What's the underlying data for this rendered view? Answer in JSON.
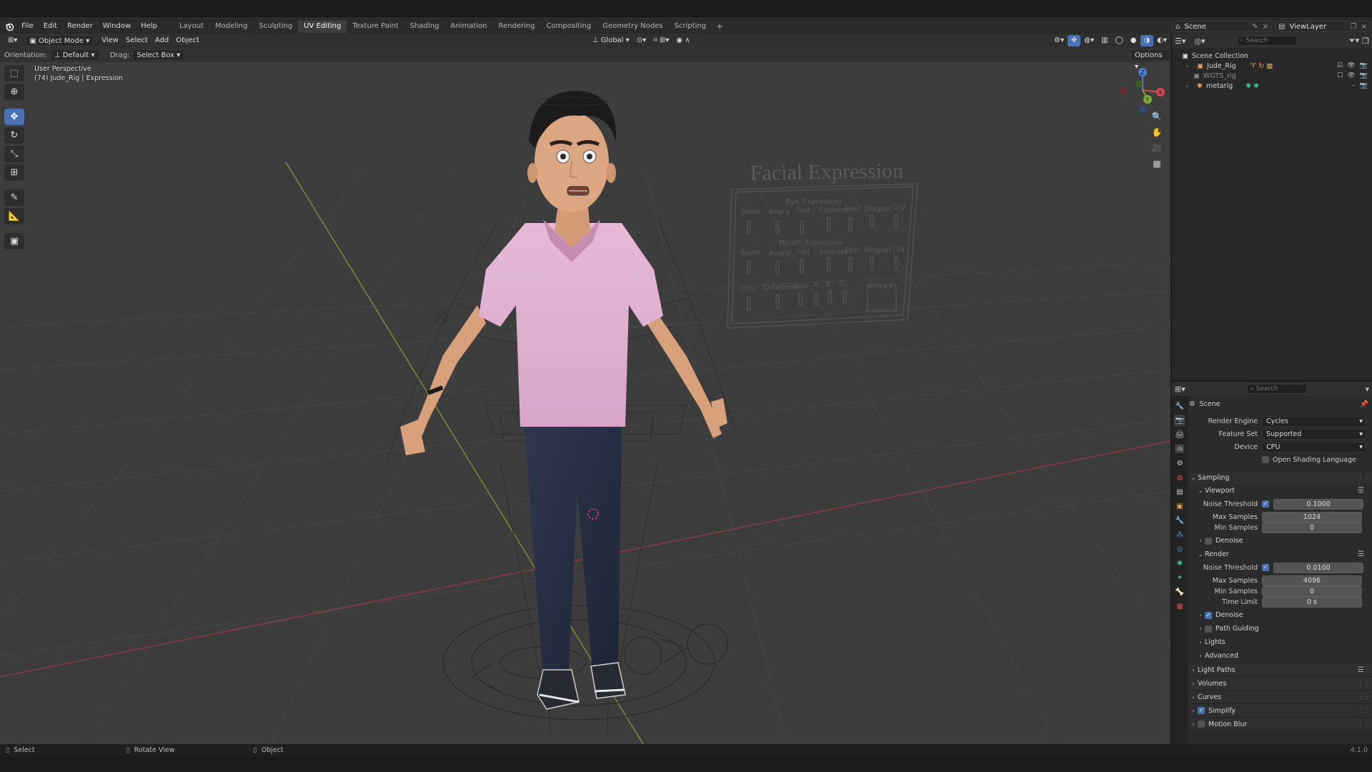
{
  "menu": [
    "File",
    "Edit",
    "Render",
    "Window",
    "Help"
  ],
  "workspaces": [
    {
      "label": "Layout",
      "active": false
    },
    {
      "label": "Modeling",
      "active": false
    },
    {
      "label": "Sculpting",
      "active": false
    },
    {
      "label": "UV Editing",
      "active": true
    },
    {
      "label": "Texture Paint",
      "active": false
    },
    {
      "label": "Shading",
      "active": false
    },
    {
      "label": "Animation",
      "active": false
    },
    {
      "label": "Rendering",
      "active": false
    },
    {
      "label": "Compositing",
      "active": false
    },
    {
      "label": "Geometry Nodes",
      "active": false
    },
    {
      "label": "Scripting",
      "active": false
    }
  ],
  "add_workspace": "+",
  "scene_selector": "Scene",
  "view_layer": "ViewLayer",
  "viewport": {
    "mode": "Object Mode",
    "menus": [
      "View",
      "Select",
      "Add",
      "Object"
    ],
    "transform_orientation": "Global",
    "orientation_label": "Orientation:",
    "orientation_value": "Default",
    "drag_label": "Drag:",
    "drag_value": "Select Box",
    "options": "Options",
    "perspective": "User Perspective",
    "object_info": "(74) Jude_Rig | Expression",
    "gizmo_axes": [
      "X",
      "Y",
      "Z"
    ]
  },
  "scene_text": {
    "board_title": "Facial Expression",
    "eye_section": "Eye_Expression",
    "eye_labels": [
      "Smile",
      "Angry",
      "Sad",
      "Surprise",
      "Fear",
      "Disgust",
      "Cry"
    ],
    "mouth_section": "Mouth_Expression",
    "mouth_labels": [
      "Smile",
      "Angry",
      "Sad",
      "Surprise",
      "Fear",
      "Disgust",
      "Cry"
    ],
    "extra_labels": [
      "Cute",
      "CuteSmile",
      "Kiss",
      "A",
      "E",
      "O"
    ],
    "blink_label": "Blink L R"
  },
  "outliner": {
    "search_placeholder": "Search",
    "root": "Scene Collection",
    "items": [
      {
        "name": "Jude_Rig",
        "dim": false
      },
      {
        "name": "WGTS_rig",
        "dim": true
      },
      {
        "name": "metarig",
        "dim": false
      }
    ]
  },
  "properties": {
    "search_placeholder": "Search",
    "context": "Scene",
    "render_engine_label": "Render Engine",
    "render_engine": "Cycles",
    "feature_set_label": "Feature Set",
    "feature_set": "Supported",
    "device_label": "Device",
    "device": "CPU",
    "osl_label": "Open Shading Language",
    "sampling": "Sampling",
    "viewport_sub": "Viewport",
    "noise_threshold_label": "Noise Threshold",
    "vp_noise_threshold": "0.1000",
    "max_samples_label": "Max Samples",
    "vp_max_samples": "1024",
    "min_samples_label": "Min Samples",
    "vp_min_samples": "0",
    "denoise": "Denoise",
    "render_sub": "Render",
    "r_noise_threshold": "0.0100",
    "r_max_samples": "4096",
    "r_min_samples": "0",
    "time_limit_label": "Time Limit",
    "r_time_limit": "0 s",
    "path_guiding": "Path Guiding",
    "lights": "Lights",
    "advanced": "Advanced",
    "light_paths": "Light Paths",
    "volumes": "Volumes",
    "curves": "Curves",
    "simplify": "Simplify",
    "motion_blur": "Motion Blur"
  },
  "status": {
    "select": "Select",
    "rotate": "Rotate View",
    "object": "Object",
    "version": "4.1.0"
  },
  "colors": {
    "accent": "#4772b3",
    "viewport_bg": "#3d3d3d",
    "shirt": "#e3b4d3",
    "jeans": "#2a3247",
    "skin": "#d9a07c"
  }
}
